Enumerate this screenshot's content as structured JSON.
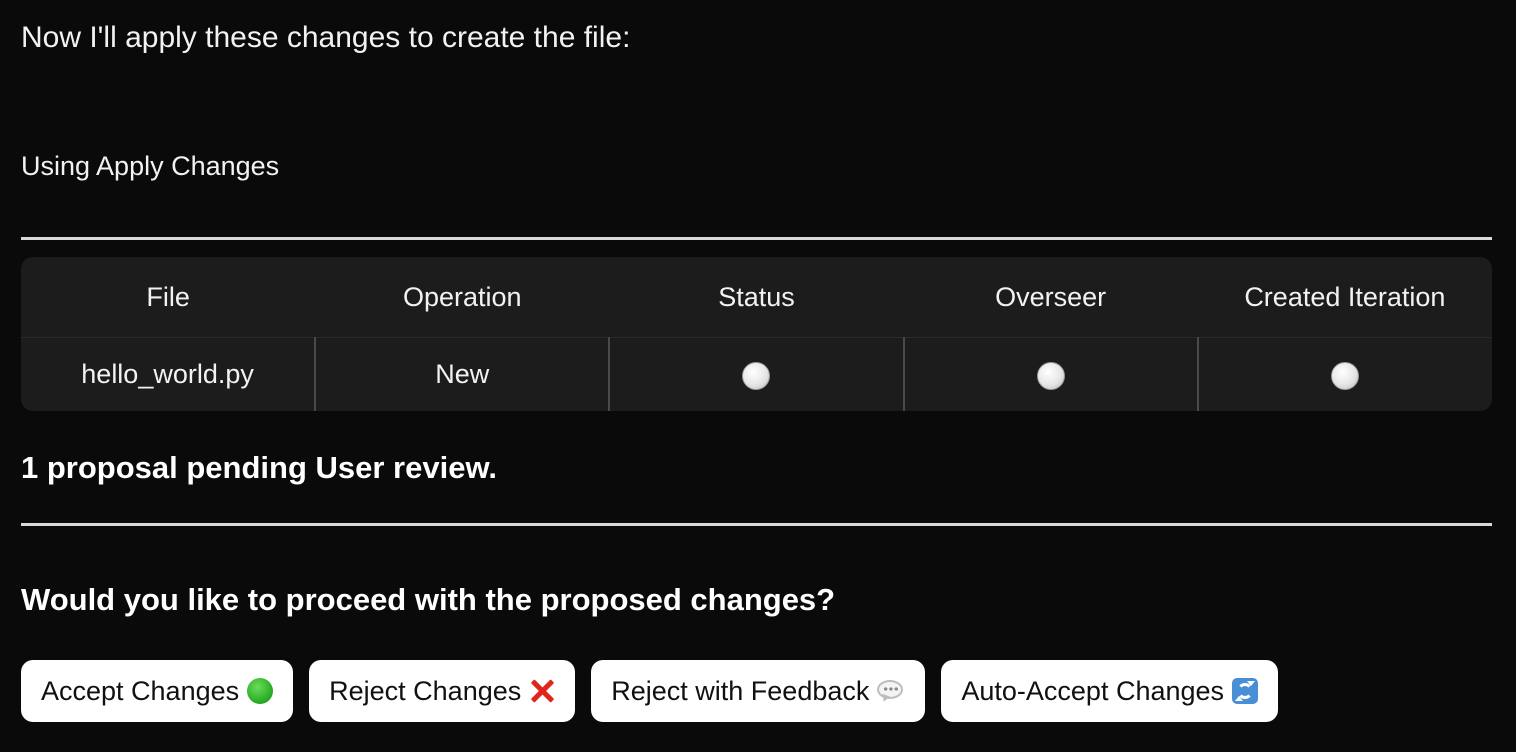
{
  "intro_text": "Now I'll apply these changes to create the file:",
  "tool_label": "Using Apply Changes",
  "table": {
    "headers": [
      "File",
      "Operation",
      "Status",
      "Overseer",
      "Created Iteration"
    ],
    "rows": [
      {
        "file": "hello_world.py",
        "operation": "New",
        "status": "white-circle-icon",
        "overseer": "white-circle-icon",
        "created_iteration": "white-circle-icon"
      }
    ]
  },
  "pending_text": "1 proposal pending User review.",
  "question_text": "Would you like to proceed with the proposed changes?",
  "actions": [
    {
      "label": "Accept Changes",
      "icon": "green-circle-icon"
    },
    {
      "label": "Reject Changes",
      "icon": "red-x-icon"
    },
    {
      "label": "Reject with Feedback",
      "icon": "speech-bubble-icon"
    },
    {
      "label": "Auto-Accept Changes",
      "icon": "refresh-icon"
    }
  ],
  "colors": {
    "background": "#0a0a0a",
    "table_background": "#1c1c1c",
    "button_background": "#ffffff",
    "divider": "#d9d9d9"
  }
}
